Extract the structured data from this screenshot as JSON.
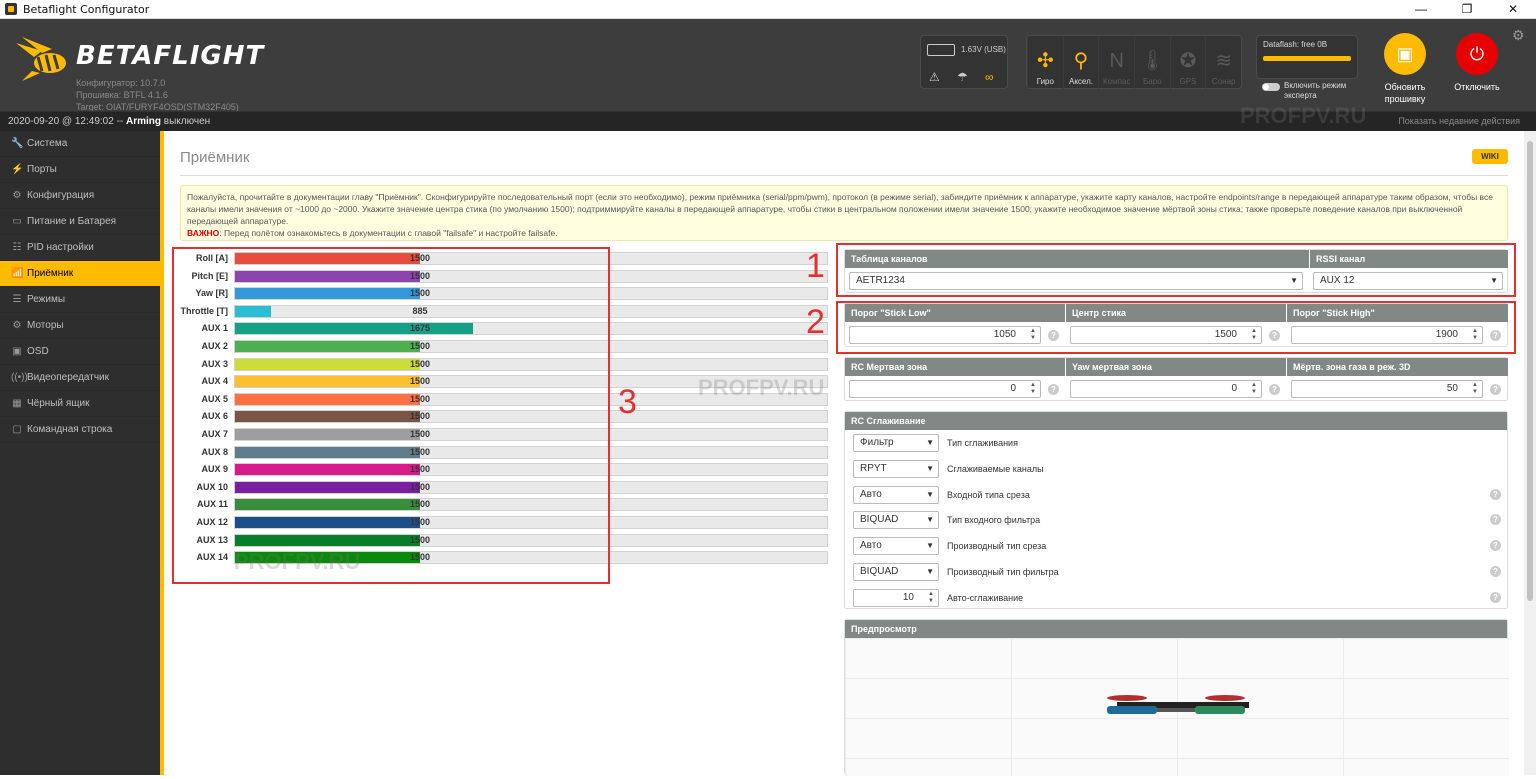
{
  "window": {
    "title": "Betaflight Configurator",
    "min": "—",
    "max": "❐",
    "close": "✕"
  },
  "header": {
    "logo_text": "BETAFLIGHT",
    "configurator": "Конфигуратор: 10.7.0",
    "firmware": "Прошивка: BTFL 4.1.6",
    "target": "Target: OIAT/FURYF4OSD(STM32F405)",
    "battery_voltage": "1.63V (USB)",
    "sensors": [
      {
        "label": "Гиро",
        "icon": "gyro-icon",
        "glyph": "✣",
        "active": true
      },
      {
        "label": "Аксел.",
        "icon": "accelerometer-icon",
        "glyph": "⚲",
        "active": true
      },
      {
        "label": "Компас",
        "icon": "compass-icon",
        "glyph": "N",
        "active": false
      },
      {
        "label": "Баро",
        "icon": "barometer-icon",
        "glyph": "🌡",
        "active": false
      },
      {
        "label": "GPS",
        "icon": "gps-icon",
        "glyph": "✪",
        "active": false
      },
      {
        "label": "Сонар",
        "icon": "sonar-icon",
        "glyph": "≋",
        "active": false
      }
    ],
    "dataflash": "Dataflash: free 0B",
    "expert_mode": "Включить режим эксперта",
    "update_button": "Обновить прошивку",
    "disconnect_button": "Отключить"
  },
  "status": {
    "datetime": "2020-09-20 @ 12:49:02 -- ",
    "arming_label": "Arming",
    "arming_state": "выключен",
    "recent_actions": "Показать недавние действия"
  },
  "sidebar": {
    "items": [
      {
        "label": "Система",
        "icon": "wrench-icon",
        "glyph": "🔧",
        "active": false
      },
      {
        "label": "Порты",
        "icon": "plug-icon",
        "glyph": "⚡",
        "active": false
      },
      {
        "label": "Конфигурация",
        "icon": "gear-icon",
        "glyph": "⚙",
        "active": false
      },
      {
        "label": "Питание и Батарея",
        "icon": "battery-icon",
        "glyph": "▭",
        "active": false
      },
      {
        "label": "PID настройки",
        "icon": "sliders-icon",
        "glyph": "☷",
        "active": false
      },
      {
        "label": "Приёмник",
        "icon": "receiver-icon",
        "glyph": "📶",
        "active": true
      },
      {
        "label": "Режимы",
        "icon": "modes-icon",
        "glyph": "☰",
        "active": false
      },
      {
        "label": "Моторы",
        "icon": "motor-icon",
        "glyph": "⚙",
        "active": false
      },
      {
        "label": "OSD",
        "icon": "osd-icon",
        "glyph": "▣",
        "active": false
      },
      {
        "label": "Видеопередатчик",
        "icon": "vtx-icon",
        "glyph": "((•))",
        "active": false
      },
      {
        "label": "Чёрный ящик",
        "icon": "blackbox-icon",
        "glyph": "▦",
        "active": false
      },
      {
        "label": "Командная строка",
        "icon": "cli-icon",
        "glyph": "▢",
        "active": false
      }
    ]
  },
  "page": {
    "title": "Приёмник",
    "wiki": "WIKI",
    "note": "Пожалуйста, прочитайте в документации главу \"Приёмник\". Сконфигурируйте последовательный порт (если это необходимо), режим приёмника (serial/ppm/pwm), протокол (в режиме serial), забиндите приёмник к аппаратуре, укажите карту каналов, настройте endpoints/range в передающей аппаратуре таким образом, чтобы все каналы имели значения от ~1000 до ~2000. Укажите значение центра стика (по умолчанию 1500); подтриммируйте каналы в передающей аппаратуре, чтобы стики в центральном положении имели значение 1500; укажите необходимое значение мёртвой зоны стика; также проверьте поведение каналов при выключенной передающей аппаратуре.",
    "note_warn_label": "ВАЖНО",
    "note_warn_text": ": Перед полётом ознакомьтесь в документации с главой \"failsafe\" и настройте failsafe."
  },
  "channels": [
    {
      "name": "Roll [A]",
      "value": 1500,
      "color": "#e74c3c"
    },
    {
      "name": "Pitch [E]",
      "value": 1500,
      "color": "#8e44ad"
    },
    {
      "name": "Yaw [R]",
      "value": 1500,
      "color": "#3498db"
    },
    {
      "name": "Throttle [T]",
      "value": 885,
      "color": "#2cbcd6"
    },
    {
      "name": "AUX 1",
      "value": 1675,
      "color": "#16a085"
    },
    {
      "name": "AUX 2",
      "value": 1500,
      "color": "#4caf50"
    },
    {
      "name": "AUX 3",
      "value": 1500,
      "color": "#cddc39"
    },
    {
      "name": "AUX 4",
      "value": 1500,
      "color": "#fbc02d"
    },
    {
      "name": "AUX 5",
      "value": 1500,
      "color": "#ff7043"
    },
    {
      "name": "AUX 6",
      "value": 1500,
      "color": "#795548"
    },
    {
      "name": "AUX 7",
      "value": 1500,
      "color": "#9e9e9e"
    },
    {
      "name": "AUX 8",
      "value": 1500,
      "color": "#607d8b"
    },
    {
      "name": "AUX 9",
      "value": 1500,
      "color": "#d81b8a"
    },
    {
      "name": "AUX 10",
      "value": 1500,
      "color": "#7b1fa2"
    },
    {
      "name": "AUX 11",
      "value": 1500,
      "color": "#388e3c"
    },
    {
      "name": "AUX 12",
      "value": 1500,
      "color": "#1a4f8a"
    },
    {
      "name": "AUX 13",
      "value": 1500,
      "color": "#0a7d2a"
    },
    {
      "name": "AUX 14",
      "value": 1500,
      "color": "#0a8a0a"
    }
  ],
  "channel_range": {
    "min": 885,
    "max": 2115
  },
  "map": {
    "header": "Таблица каналов",
    "value": "AETR1234",
    "rssi_header": "RSSI канал",
    "rssi_value": "AUX 12"
  },
  "stick": {
    "low_header": "Порог \"Stick Low\"",
    "low": "1050",
    "center_header": "Центр стика",
    "center": "1500",
    "high_header": "Порог \"Stick High\"",
    "high": "1900"
  },
  "deadband": {
    "rc_header": "RC Мертвая зона",
    "rc": "0",
    "yaw_header": "Yaw мертвая зона",
    "yaw": "0",
    "d3_header": "Мёртв. зона газа в реж. 3D",
    "d3": "50"
  },
  "smoothing": {
    "header": "RC Сглаживание",
    "rows": [
      {
        "value": "Фильтр",
        "label": "Тип сглаживания",
        "kind": "select",
        "help": false
      },
      {
        "value": "RPYT",
        "label": "Сглаживаемые каналы",
        "kind": "select",
        "help": false
      },
      {
        "value": "Авто",
        "label": "Входной типа среза",
        "kind": "select",
        "help": true
      },
      {
        "value": "BIQUAD",
        "label": "Тип входного фильтра",
        "kind": "select",
        "help": true
      },
      {
        "value": "Авто",
        "label": "Производный тип среза",
        "kind": "select",
        "help": true
      },
      {
        "value": "BIQUAD",
        "label": "Производный тип фильтра",
        "kind": "select",
        "help": true
      },
      {
        "value": "10",
        "label": "Авто-сглаживание",
        "kind": "number",
        "help": true
      }
    ]
  },
  "preview": {
    "header": "Предпросмотр"
  },
  "annotations": {
    "n1": "1",
    "n2": "2",
    "n3": "3",
    "watermark": "PROFPV.RU"
  },
  "colors": {
    "accent": "#ffbb00",
    "dark": "#3d3d3d",
    "highlight": "#e53030"
  }
}
